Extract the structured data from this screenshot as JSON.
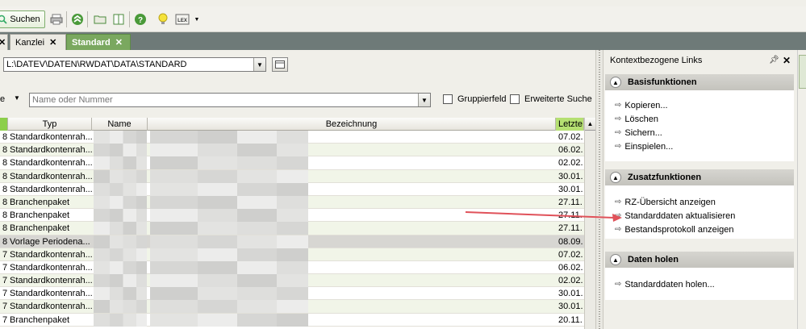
{
  "toolbar": {
    "search_label": "Suchen"
  },
  "tabs": [
    {
      "label": "Kanzlei",
      "active": false
    },
    {
      "label": "Standard",
      "active": true
    }
  ],
  "left": {
    "path_value": "L:\\DATEV\\DATEN\\RWDAT\\DATA\\STANDARD",
    "filter_label": "e",
    "name_placeholder": "Name oder Nummer",
    "grouping_label": "Gruppierfeld",
    "extended_search_label": "Erweiterte Suche",
    "columns": {
      "type": "Typ",
      "name": "Name",
      "description": "Bezeichnung",
      "last": "Letzte"
    },
    "rows": [
      {
        "n": "8",
        "type": "Standardkontenrah...",
        "date": "07.02."
      },
      {
        "n": "8",
        "type": "Standardkontenrah...",
        "date": "06.02."
      },
      {
        "n": "8",
        "type": "Standardkontenrah...",
        "date": "02.02."
      },
      {
        "n": "8",
        "type": "Standardkontenrah...",
        "date": "30.01."
      },
      {
        "n": "8",
        "type": "Standardkontenrah...",
        "date": "30.01."
      },
      {
        "n": "8",
        "type": "Branchenpaket",
        "date": "27.11."
      },
      {
        "n": "8",
        "type": "Branchenpaket",
        "date": "27.11."
      },
      {
        "n": "8",
        "type": "Branchenpaket",
        "date": "27.11."
      },
      {
        "n": "8",
        "type": "Vorlage  Periodena...",
        "date": "08.09."
      },
      {
        "n": "7",
        "type": "Standardkontenrah...",
        "date": "07.02."
      },
      {
        "n": "7",
        "type": "Standardkontenrah...",
        "date": "06.02."
      },
      {
        "n": "7",
        "type": "Standardkontenrah...",
        "date": "02.02."
      },
      {
        "n": "7",
        "type": "Standardkontenrah...",
        "date": "30.01."
      },
      {
        "n": "7",
        "type": "Standardkontenrah...",
        "date": "30.01."
      },
      {
        "n": "7",
        "type": "Branchenpaket",
        "date": "20.11."
      }
    ]
  },
  "right": {
    "title": "Kontextbezogene Links",
    "sections": [
      {
        "title": "Basisfunktionen",
        "links": [
          "Kopieren...",
          "Löschen",
          "Sichern...",
          "Einspielen..."
        ]
      },
      {
        "title": "Zusatzfunktionen",
        "links": [
          "RZ-Übersicht anzeigen",
          "Standarddaten aktualisieren",
          "Bestandsprotokoll anzeigen"
        ]
      },
      {
        "title": "Daten holen",
        "links": [
          "Standarddaten holen..."
        ]
      }
    ]
  },
  "colors": {
    "active_tab": "#7aa85f",
    "tab_strip": "#6e7a78",
    "annotation_arrow": "#e0525a"
  }
}
